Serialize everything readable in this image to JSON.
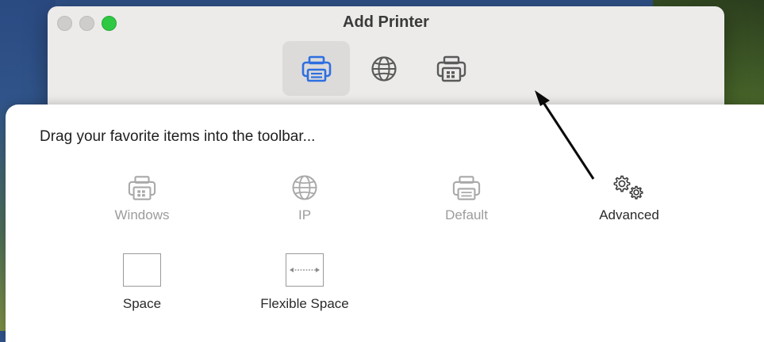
{
  "window": {
    "title": "Add Printer"
  },
  "toolbar": {
    "buttons": [
      {
        "id": "default",
        "icon": "printer-icon",
        "selected": true
      },
      {
        "id": "ip",
        "icon": "globe-icon",
        "selected": false
      },
      {
        "id": "windows",
        "icon": "windows-printer-icon",
        "selected": false
      }
    ]
  },
  "customize": {
    "heading": "Drag your favorite items into the toolbar...",
    "items": [
      {
        "label": "Windows",
        "icon": "windows-printer-icon",
        "enabled": false
      },
      {
        "label": "IP",
        "icon": "globe-icon",
        "enabled": false
      },
      {
        "label": "Default",
        "icon": "printer-icon",
        "enabled": false
      },
      {
        "label": "Advanced",
        "icon": "gears-icon",
        "enabled": true
      }
    ],
    "space_label": "Space",
    "flexible_space_label": "Flexible Space"
  },
  "colors": {
    "accent": "#2f6fe0",
    "zoom_button": "#2fc843",
    "disabled_text": "#9c9c9c"
  }
}
